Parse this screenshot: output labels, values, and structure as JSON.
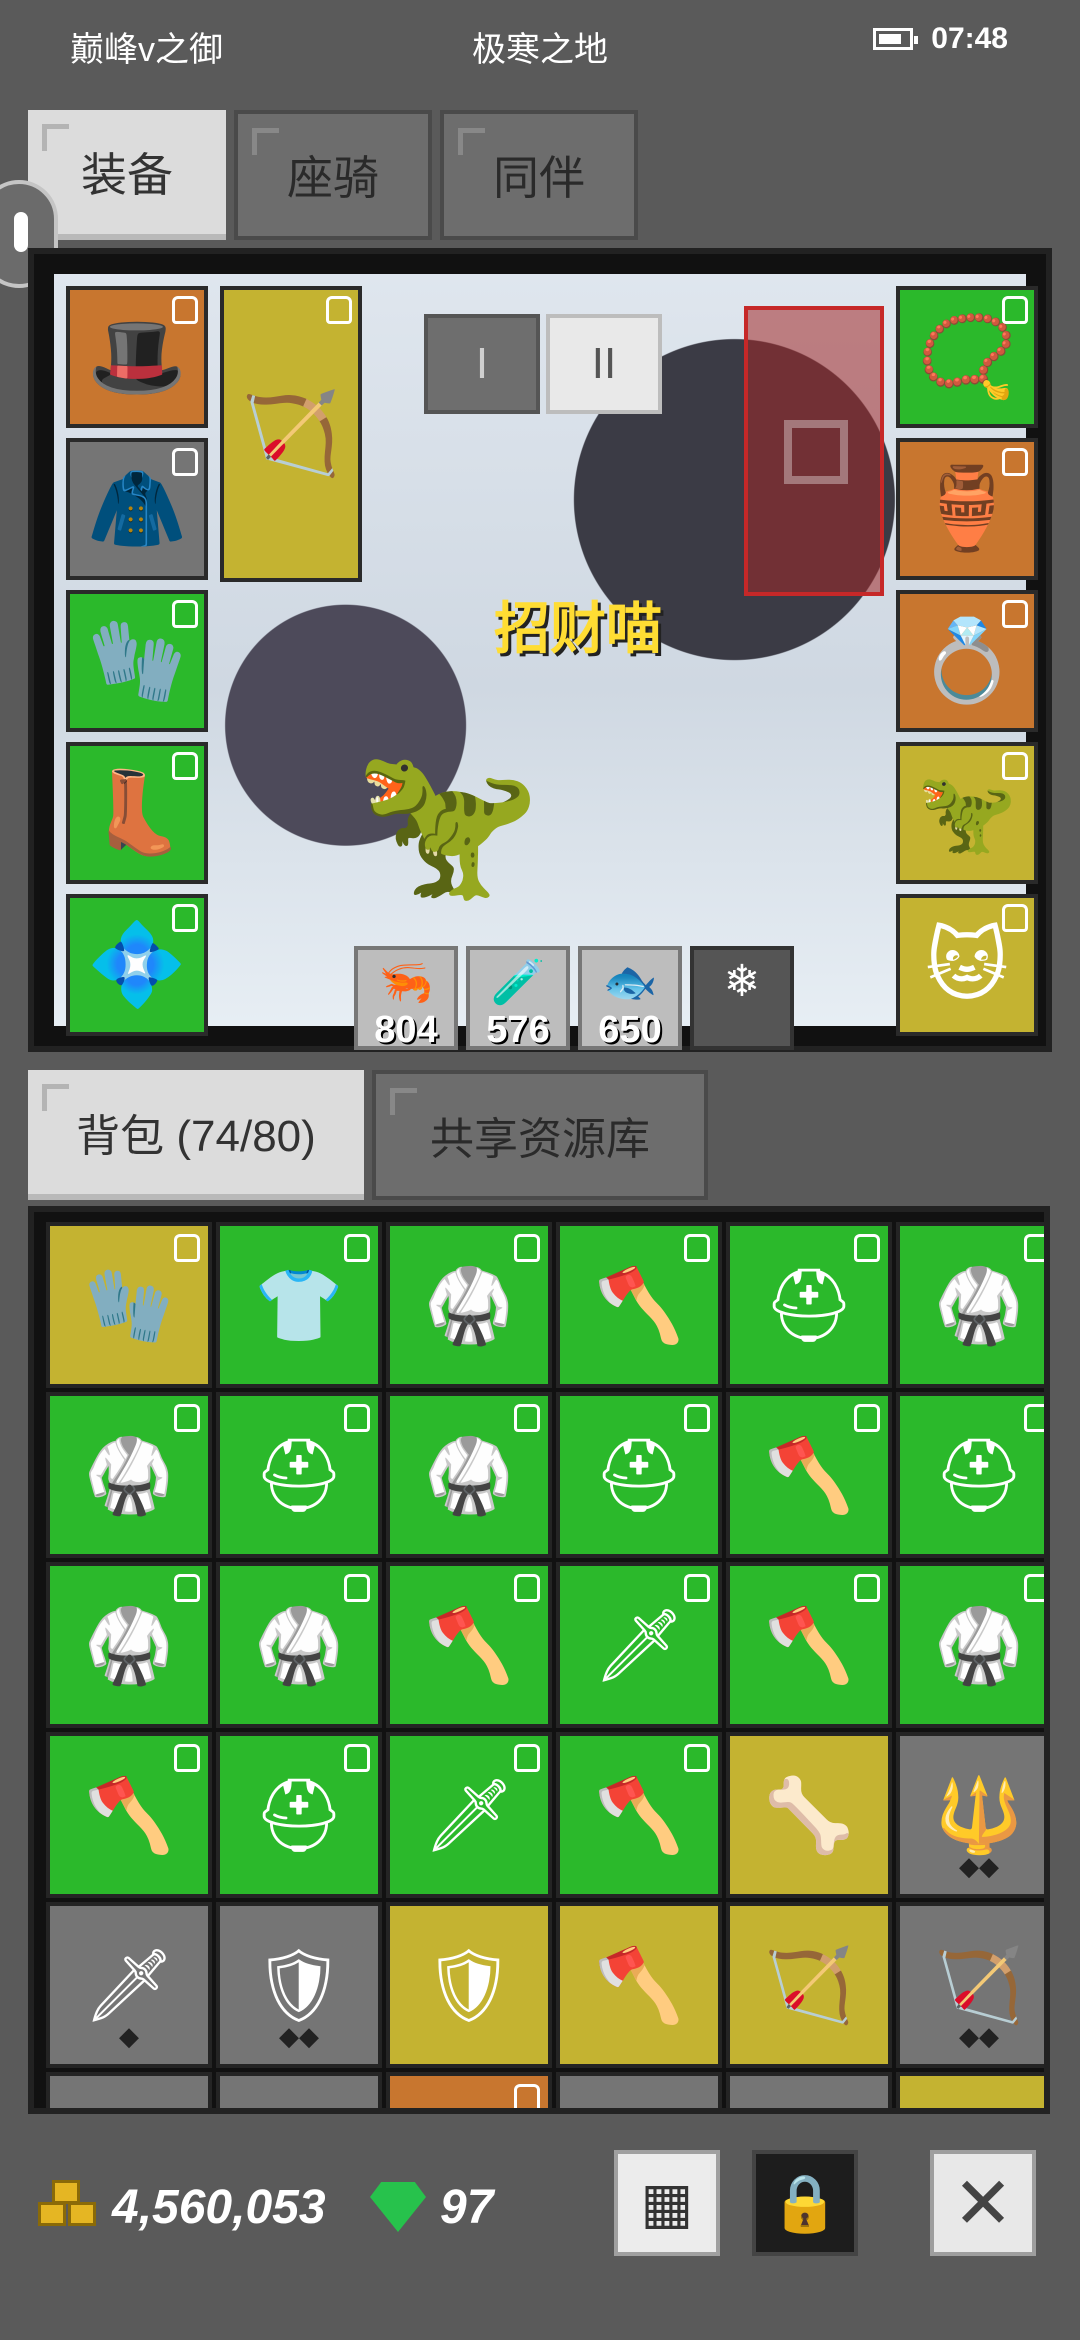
{
  "status_bar": {
    "left": "巅峰v之御",
    "center": "极寒之地",
    "time": "07:48"
  },
  "top_tabs": [
    "装备",
    "座骑",
    "同伴"
  ],
  "mode_buttons": [
    "I",
    "II"
  ],
  "character_name": "招财喵",
  "equipment": {
    "left_col": [
      {
        "icon": "🎩",
        "rarity": "orange"
      },
      {
        "icon": "🧥",
        "rarity": "gray"
      },
      {
        "icon": "🧤",
        "rarity": "green"
      },
      {
        "icon": "👢",
        "rarity": "green"
      },
      {
        "icon": "💠",
        "rarity": "green"
      }
    ],
    "weapon": {
      "icon": "🏹",
      "rarity": "yellow"
    },
    "right_col": [
      {
        "icon": "📿",
        "rarity": "green"
      },
      {
        "icon": "🏺",
        "rarity": "orange"
      },
      {
        "icon": "💍",
        "rarity": "orange"
      },
      {
        "icon": "🦖",
        "rarity": "yellow"
      },
      {
        "icon": "🐱",
        "rarity": "yellow"
      }
    ]
  },
  "consumables": [
    {
      "icon": "🦐",
      "count": "804"
    },
    {
      "icon": "🧪",
      "count": "576"
    },
    {
      "icon": "🐟",
      "count": "650"
    },
    {
      "icon": "",
      "count": ""
    }
  ],
  "bag_tabs": [
    "背包 (74/80)",
    "共享资源库"
  ],
  "inventory": [
    {
      "icon": "🧤",
      "rarity": "yellow",
      "lock": true
    },
    {
      "icon": "👕",
      "rarity": "green",
      "lock": true
    },
    {
      "icon": "🥋",
      "rarity": "green",
      "lock": true
    },
    {
      "icon": "🪓",
      "rarity": "green",
      "lock": true
    },
    {
      "icon": "⛑",
      "rarity": "green",
      "lock": true
    },
    {
      "icon": "🥋",
      "rarity": "green",
      "lock": true
    },
    {
      "icon": "🥋",
      "rarity": "green",
      "lock": true
    },
    {
      "icon": "⛑",
      "rarity": "green",
      "lock": true
    },
    {
      "icon": "🥋",
      "rarity": "green",
      "lock": true
    },
    {
      "icon": "⛑",
      "rarity": "green",
      "lock": true
    },
    {
      "icon": "🪓",
      "rarity": "green",
      "lock": true
    },
    {
      "icon": "⛑",
      "rarity": "green",
      "lock": true
    },
    {
      "icon": "🥋",
      "rarity": "green",
      "lock": true
    },
    {
      "icon": "🥋",
      "rarity": "green",
      "lock": true
    },
    {
      "icon": "🪓",
      "rarity": "green",
      "lock": true
    },
    {
      "icon": "🗡",
      "rarity": "green",
      "lock": true
    },
    {
      "icon": "🪓",
      "rarity": "green",
      "lock": true
    },
    {
      "icon": "🥋",
      "rarity": "green",
      "lock": true
    },
    {
      "icon": "🪓",
      "rarity": "green",
      "lock": true
    },
    {
      "icon": "⛑",
      "rarity": "green",
      "lock": true
    },
    {
      "icon": "🗡",
      "rarity": "green",
      "lock": true
    },
    {
      "icon": "🪓",
      "rarity": "green",
      "lock": true
    },
    {
      "icon": "🦴",
      "rarity": "yellow",
      "lock": false
    },
    {
      "icon": "🔱",
      "rarity": "gray",
      "lock": false,
      "pips": "◆◆"
    },
    {
      "icon": "🗡",
      "rarity": "gray",
      "lock": false,
      "pips": "◆"
    },
    {
      "icon": "🛡",
      "rarity": "gray",
      "lock": false,
      "pips": "◆◆"
    },
    {
      "icon": "🛡",
      "rarity": "yellow",
      "lock": false
    },
    {
      "icon": "🪓",
      "rarity": "yellow",
      "lock": false
    },
    {
      "icon": "🏹",
      "rarity": "yellow",
      "lock": false
    },
    {
      "icon": "🏹",
      "rarity": "gray",
      "lock": false,
      "pips": "◆◆"
    },
    {
      "icon": "🪨",
      "rarity": "gray",
      "lock": false
    },
    {
      "icon": "👹",
      "rarity": "gray",
      "lock": false
    },
    {
      "icon": "🎭",
      "rarity": "orange",
      "lock": true
    },
    {
      "icon": "🪓",
      "rarity": "gray",
      "lock": false
    },
    {
      "icon": "🪓",
      "rarity": "gray",
      "lock": false
    },
    {
      "icon": "🛡",
      "rarity": "yellow",
      "lock": false
    }
  ],
  "currency": {
    "gold": "4,560,053",
    "gems": "97"
  },
  "colors": {
    "green": "#2bb92b",
    "yellow": "#c4b331",
    "orange": "#c8762f",
    "gray": "#757575"
  }
}
